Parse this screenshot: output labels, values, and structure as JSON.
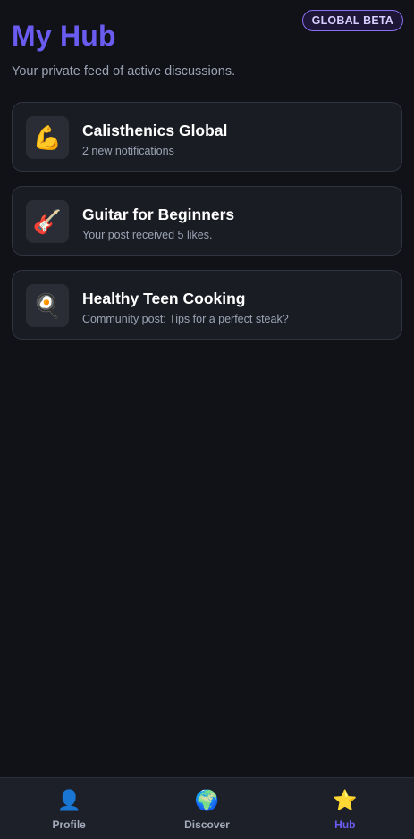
{
  "header": {
    "title": "My Hub",
    "subtitle": "Your private feed of active discussions.",
    "badge": "GLOBAL BETA"
  },
  "feed": {
    "items": [
      {
        "icon": "flexed-biceps-icon",
        "icon_glyph": "💪",
        "title": "Calisthenics Global",
        "subtitle": "2 new notifications"
      },
      {
        "icon": "guitar-icon",
        "icon_glyph": "🎸",
        "title": "Guitar for Beginners",
        "subtitle": "Your post received 5 likes."
      },
      {
        "icon": "cooking-pan-icon",
        "icon_glyph": "🍳",
        "title": "Healthy Teen Cooking",
        "subtitle": "Community post: Tips for a perfect steak?"
      }
    ]
  },
  "nav": {
    "items": [
      {
        "icon": "person-icon",
        "icon_glyph": "👤",
        "label": "Profile",
        "active": false
      },
      {
        "icon": "globe-icon",
        "icon_glyph": "🌍",
        "label": "Discover",
        "active": false
      },
      {
        "icon": "star-icon",
        "icon_glyph": "⭐",
        "label": "Hub",
        "active": true
      }
    ]
  },
  "colors": {
    "background": "#111217",
    "accent": "#6a5cf0",
    "card": "#1a1c23",
    "muted_text": "#9aa3b4"
  }
}
